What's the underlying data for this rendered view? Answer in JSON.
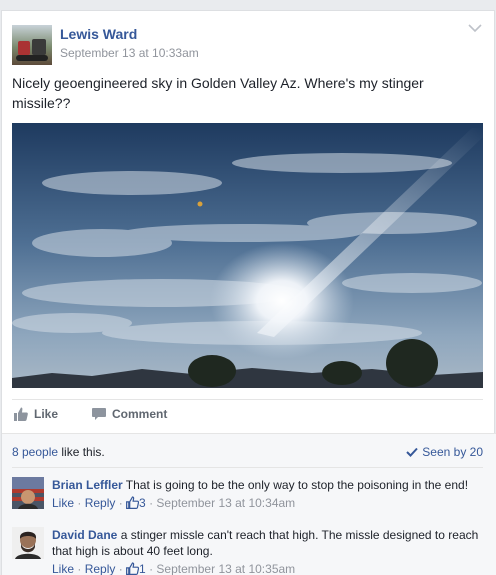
{
  "post": {
    "author": "Lewis Ward",
    "timestamp": "September 13 at 10:33am",
    "text": "Nicely geoengineered sky in Golden Valley Az. Where's my stinger missile??",
    "like_label": "Like",
    "comment_label": "Comment"
  },
  "reactions": {
    "likes_link": "8 people",
    "likes_suffix": " like this.",
    "seen_by": "Seen by 20"
  },
  "comments": [
    {
      "author": "Brian Leffler",
      "text": " That is going to be the only way to stop the poisoning in the end!",
      "like_label": "Like",
      "reply_label": "Reply",
      "like_count": "3",
      "timestamp": "September 13 at 10:34am"
    },
    {
      "author": "David Dane",
      "text": " a stinger missle can't reach that high. The missle designed to reach that high is about 40 feet long.",
      "like_label": "Like",
      "reply_label": "Reply",
      "like_count": "1",
      "timestamp": "September 13 at 10:35am"
    }
  ],
  "colors": {
    "link": "#365899",
    "muted": "#90949c",
    "text": "#1d2129",
    "background": "#e9ebee"
  },
  "icons": [
    "chevron-down-icon",
    "thumbs-up-icon",
    "comment-icon",
    "checkmark-icon",
    "thumbs-up-outline-icon"
  ]
}
